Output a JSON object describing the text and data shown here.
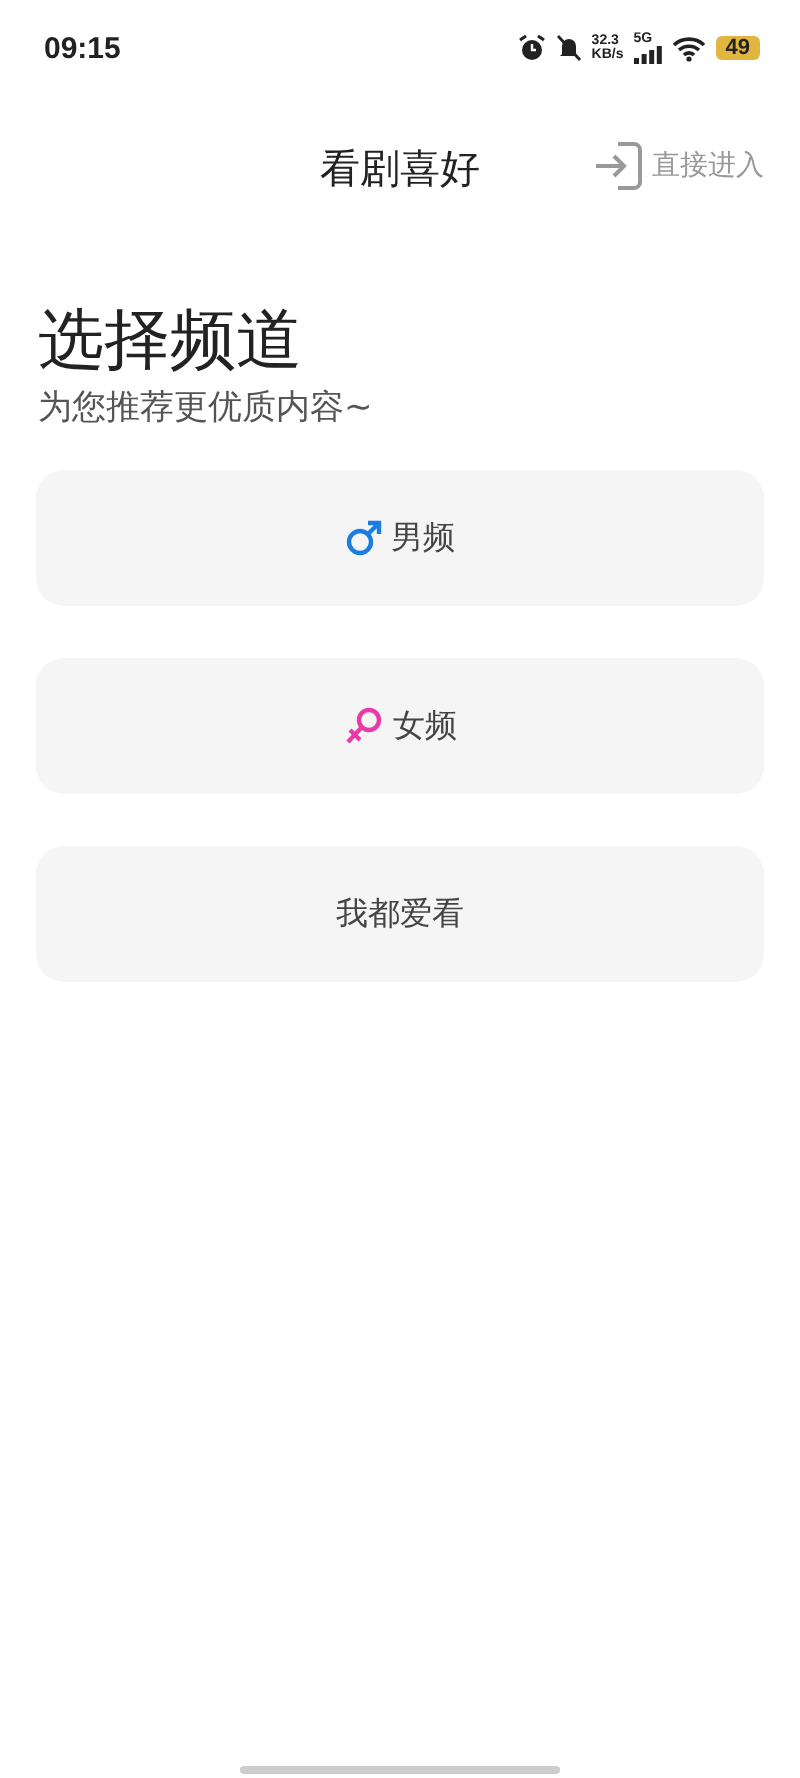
{
  "status_bar": {
    "time": "09:15",
    "speed": "32.3",
    "speed_unit": "KB/s",
    "network": "5G",
    "battery": "49"
  },
  "header": {
    "title": "看剧喜好",
    "skip": "直接进入"
  },
  "heading": "选择频道",
  "subheading": "为您推荐更优质内容~",
  "options": [
    {
      "kind": "male",
      "label": "男频"
    },
    {
      "kind": "female",
      "label": "女频"
    },
    {
      "kind": "all",
      "label": "我都爱看"
    }
  ]
}
